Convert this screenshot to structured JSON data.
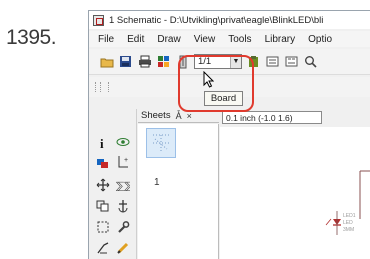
{
  "step_number": "1395.",
  "window": {
    "title": "1 Schematic - D:\\Utvikling\\privat\\eagle\\BlinkLED\\bli"
  },
  "menu": {
    "items": [
      "File",
      "Edit",
      "Draw",
      "View",
      "Tools",
      "Library",
      "Optio"
    ]
  },
  "toolbar": {
    "sheet_select_value": "1/1",
    "tooltip_text": "Board"
  },
  "sheets_panel": {
    "label": "Sheets",
    "pin_glyph": "Ǡ",
    "close_glyph": "×",
    "sheet_number": "1"
  },
  "canvas": {
    "coordinate_readout": "0.1 inch (-1.0 1.6)"
  },
  "colors": {
    "highlight": "#e03a2e",
    "tooltip_bg": "#f9f9f3",
    "sheet_thumb": "#dcebf9"
  }
}
